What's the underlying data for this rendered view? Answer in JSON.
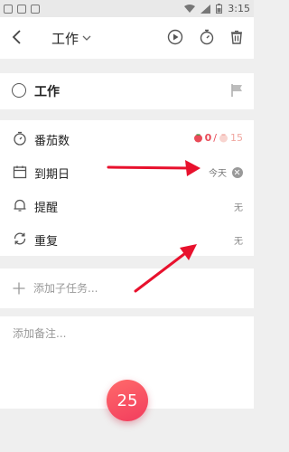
{
  "status_bar": {
    "time": "3:15"
  },
  "header": {
    "title": "工作"
  },
  "task": {
    "name": "工作"
  },
  "settings": {
    "pomodoro": {
      "label": "番茄数",
      "done": "0",
      "separator": "/",
      "estimate": "15"
    },
    "due_date": {
      "label": "到期日",
      "value": "今天"
    },
    "reminder": {
      "label": "提醒",
      "value": "无"
    },
    "repeat": {
      "label": "重复",
      "value": "无"
    }
  },
  "subtask": {
    "placeholder": "添加子任务..."
  },
  "notes": {
    "placeholder": "添加备注..."
  },
  "fab": {
    "label": "25"
  },
  "colors": {
    "accent": "#f23d5e",
    "annotation_arrow": "#e8112d"
  }
}
